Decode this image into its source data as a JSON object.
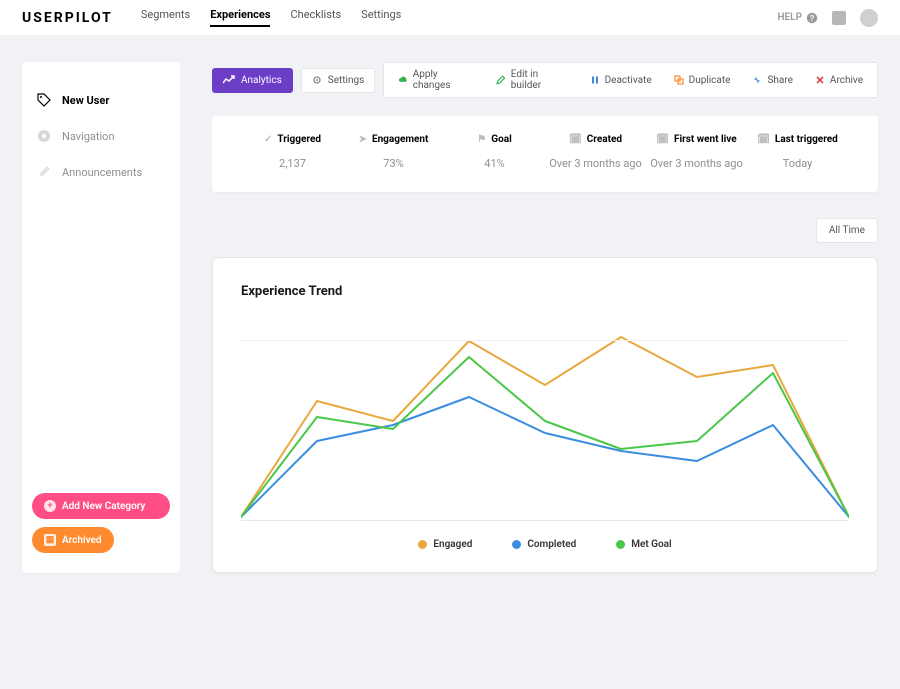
{
  "brand": "USERPILOT",
  "nav": {
    "items": [
      "Segments",
      "Experiences",
      "Checklists",
      "Settings"
    ],
    "active_index": 1,
    "help_label": "HELP"
  },
  "sidebar": {
    "items": [
      {
        "label": "New User",
        "icon": "tag-icon",
        "active": true
      },
      {
        "label": "Navigation",
        "icon": "dot-icon",
        "active": false
      },
      {
        "label": "Announcements",
        "icon": "pen-icon",
        "active": false
      }
    ],
    "add_label": "Add New Category",
    "archived_label": "Archived"
  },
  "toolbar": {
    "analytics_label": "Analytics",
    "settings_label": "Settings",
    "actions": {
      "apply": {
        "label": "Apply changes",
        "color": "#32b352"
      },
      "edit": {
        "label": "Edit in builder",
        "color": "#32b352"
      },
      "deactivate": {
        "label": "Deactivate",
        "color": "#3a8de0"
      },
      "duplicate": {
        "label": "Duplicate",
        "color": "#ff8a30"
      },
      "share": {
        "label": "Share",
        "color": "#3a8de0"
      },
      "archive": {
        "label": "Archive",
        "color": "#e04545"
      }
    }
  },
  "stats": [
    {
      "label": "Triggered",
      "value": "2,137",
      "icon": "✓"
    },
    {
      "label": "Engagement",
      "value": "73%",
      "icon": "➤"
    },
    {
      "label": "Goal",
      "value": "41%",
      "icon": "⚑"
    },
    {
      "label": "Created",
      "value": "Over 3 months ago",
      "icon": "🗓"
    },
    {
      "label": "First went live",
      "value": "Over 3 months ago",
      "icon": "🗓"
    },
    {
      "label": "Last triggered",
      "value": "Today",
      "icon": "🗓"
    }
  ],
  "filter": {
    "label": "All Time"
  },
  "chart_title": "Experience Trend",
  "chart_data": {
    "type": "line",
    "title": "Experience Trend",
    "xlabel": "",
    "ylabel": "",
    "ylim": [
      0,
      100
    ],
    "x": [
      0,
      1,
      2,
      3,
      4,
      5,
      6,
      7,
      8
    ],
    "series": [
      {
        "name": "Engaged",
        "color": "#e8a83e",
        "values": [
          2,
          60,
          50,
          90,
          68,
          92,
          72,
          78,
          2
        ]
      },
      {
        "name": "Completed",
        "color": "#3a8de0",
        "values": [
          2,
          40,
          48,
          62,
          44,
          35,
          30,
          48,
          2
        ]
      },
      {
        "name": "Met Goal",
        "color": "#4ac74a",
        "values": [
          2,
          52,
          46,
          82,
          50,
          36,
          40,
          74,
          2
        ]
      }
    ],
    "grid": true,
    "legend_position": "bottom"
  }
}
